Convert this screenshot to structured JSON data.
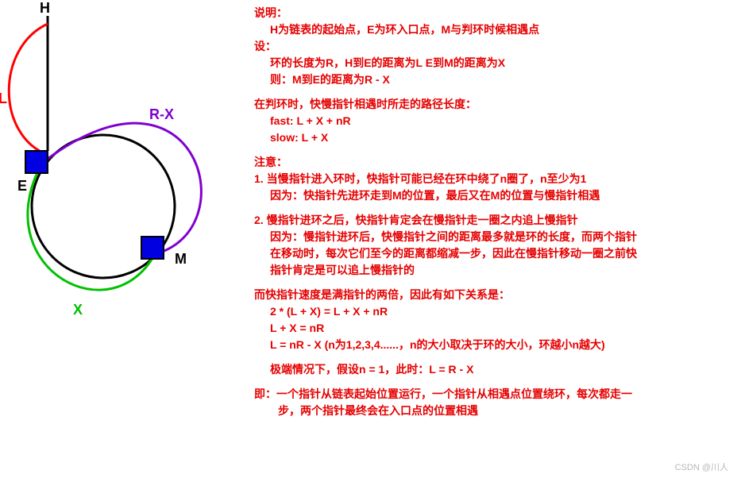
{
  "diagram": {
    "labels": {
      "H": "H",
      "E": "E",
      "M": "M",
      "L": "L",
      "X": "X",
      "RX": "R-X"
    }
  },
  "text": {
    "t1": "说明：",
    "t2": "H为链表的起始点，E为环入口点，M与判环时候相遇点",
    "t3": "设：",
    "t4": "环的长度为R，H到E的距离为L   E到M的距离为X",
    "t5": "则：M到E的距离为R - X",
    "t6": "在判环时，快慢指针相遇时所走的路径长度：",
    "t7": "fast:  L + X + nR",
    "t8": "slow:  L + X",
    "t9": "注意：",
    "t10": "1. 当慢指针进入环时，快指针可能已经在环中绕了n圈了，n至少为1",
    "t11": "因为：快指针先进环走到M的位置，最后又在M的位置与慢指针相遇",
    "t12": "2. 慢指针进环之后，快指针肯定会在慢指针走一圈之内追上慢指针",
    "t13": "因为：慢指针进环后，快慢指针之间的距离最多就是环的长度，而两个指针",
    "t14": "在移动时，每次它们至今的距离都缩减一步，因此在慢指针移动一圈之前快",
    "t15": "指针肯定是可以追上慢指针的",
    "t16": "而快指针速度是满指针的两倍，因此有如下关系是：",
    "t17": "2 * (L + X) = L + X + nR",
    "t18": "L + X = nR",
    "t19": "L = nR - X     (n为1,2,3,4......，n的大小取决于环的大小，环越小n越大)",
    "t20": "极端情况下，假设n = 1，此时：L = R - X",
    "t21": "即：一个指针从链表起始位置运行，一个指针从相遇点位置绕环，每次都走一",
    "t22": "步，两个指针最终会在入口点的位置相遇"
  },
  "watermark": "CSDN @川人"
}
